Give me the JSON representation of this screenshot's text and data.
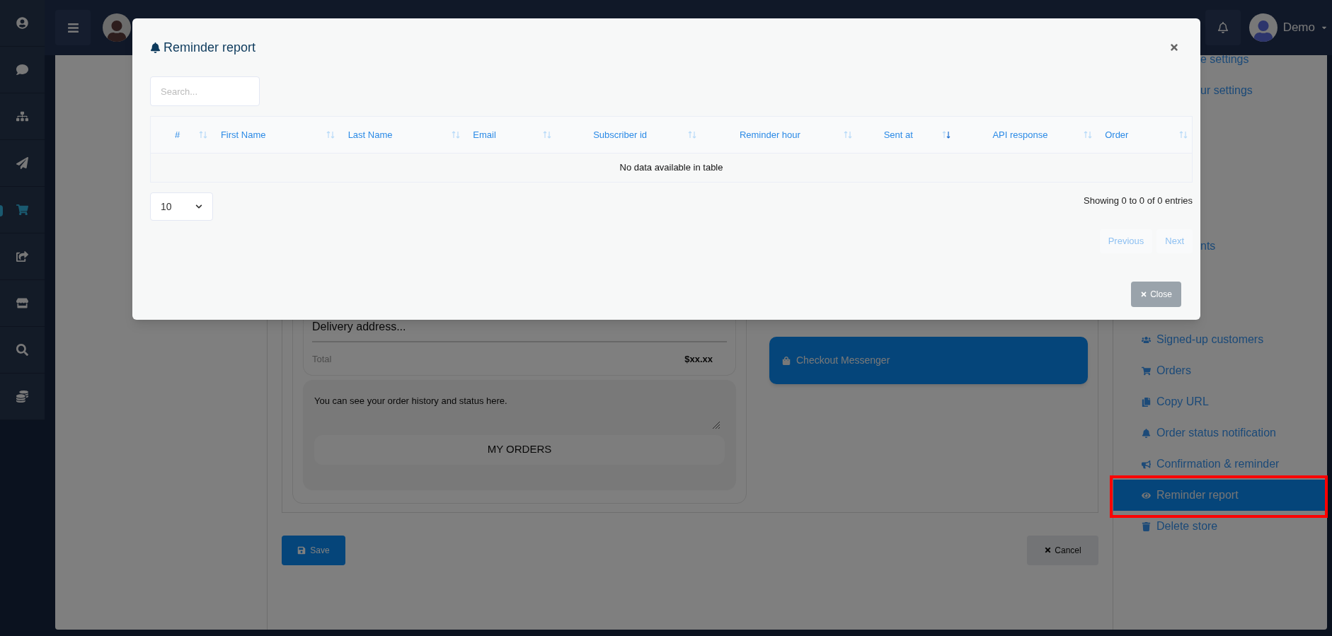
{
  "sidebar": {
    "items": [
      {
        "selected": false
      },
      {
        "selected": false
      },
      {
        "selected": false
      },
      {
        "selected": false
      },
      {
        "selected": true
      },
      {
        "selected": false
      },
      {
        "selected": false
      },
      {
        "selected": false
      },
      {
        "selected": false
      }
    ]
  },
  "header": {
    "user": "Demo"
  },
  "content": {
    "delivery": "Delivery address...",
    "total_label": "Total",
    "total_value": "$xx.xx",
    "history_text": "You can see your order history and status here.",
    "my_orders": "MY ORDERS",
    "checkout": "Checkout Messenger",
    "save": "Save",
    "cancel": "Cancel"
  },
  "menu": [
    {
      "label": "e settings",
      "selected": false
    },
    {
      "label": "ur settings",
      "selected": false
    },
    {
      "label": "nts",
      "selected": false
    },
    {
      "label": "Signed-up customers",
      "selected": false
    },
    {
      "label": "Orders",
      "selected": false
    },
    {
      "label": "Copy URL",
      "selected": false
    },
    {
      "label": "Order status notification",
      "selected": false
    },
    {
      "label": "Confirmation & reminder",
      "selected": false
    },
    {
      "label": "Reminder report",
      "selected": true
    },
    {
      "label": "Delete store",
      "selected": false
    }
  ],
  "modal": {
    "title": "Reminder report",
    "search": {
      "placeholder": "Search..."
    },
    "table": {
      "columns": [
        {
          "label": "#",
          "sorted": false
        },
        {
          "label": "First Name",
          "sorted": false
        },
        {
          "label": "Last Name",
          "sorted": false
        },
        {
          "label": "Email",
          "sorted": false
        },
        {
          "label": "Subscriber id",
          "sorted": false
        },
        {
          "label": "Reminder hour",
          "sorted": false
        },
        {
          "label": "Sent at",
          "sorted": true
        },
        {
          "label": "API response",
          "sorted": false
        },
        {
          "label": "Order",
          "sorted": false
        }
      ],
      "empty": "No data available in table"
    },
    "page_size": "10",
    "info": "Showing 0 to 0 of 0 entries",
    "pagination": [
      {
        "label": "Previous",
        "disabled": true
      },
      {
        "label": "Next",
        "disabled": true
      }
    ],
    "close": {
      "label": "Close",
      "disabled": true
    }
  }
}
